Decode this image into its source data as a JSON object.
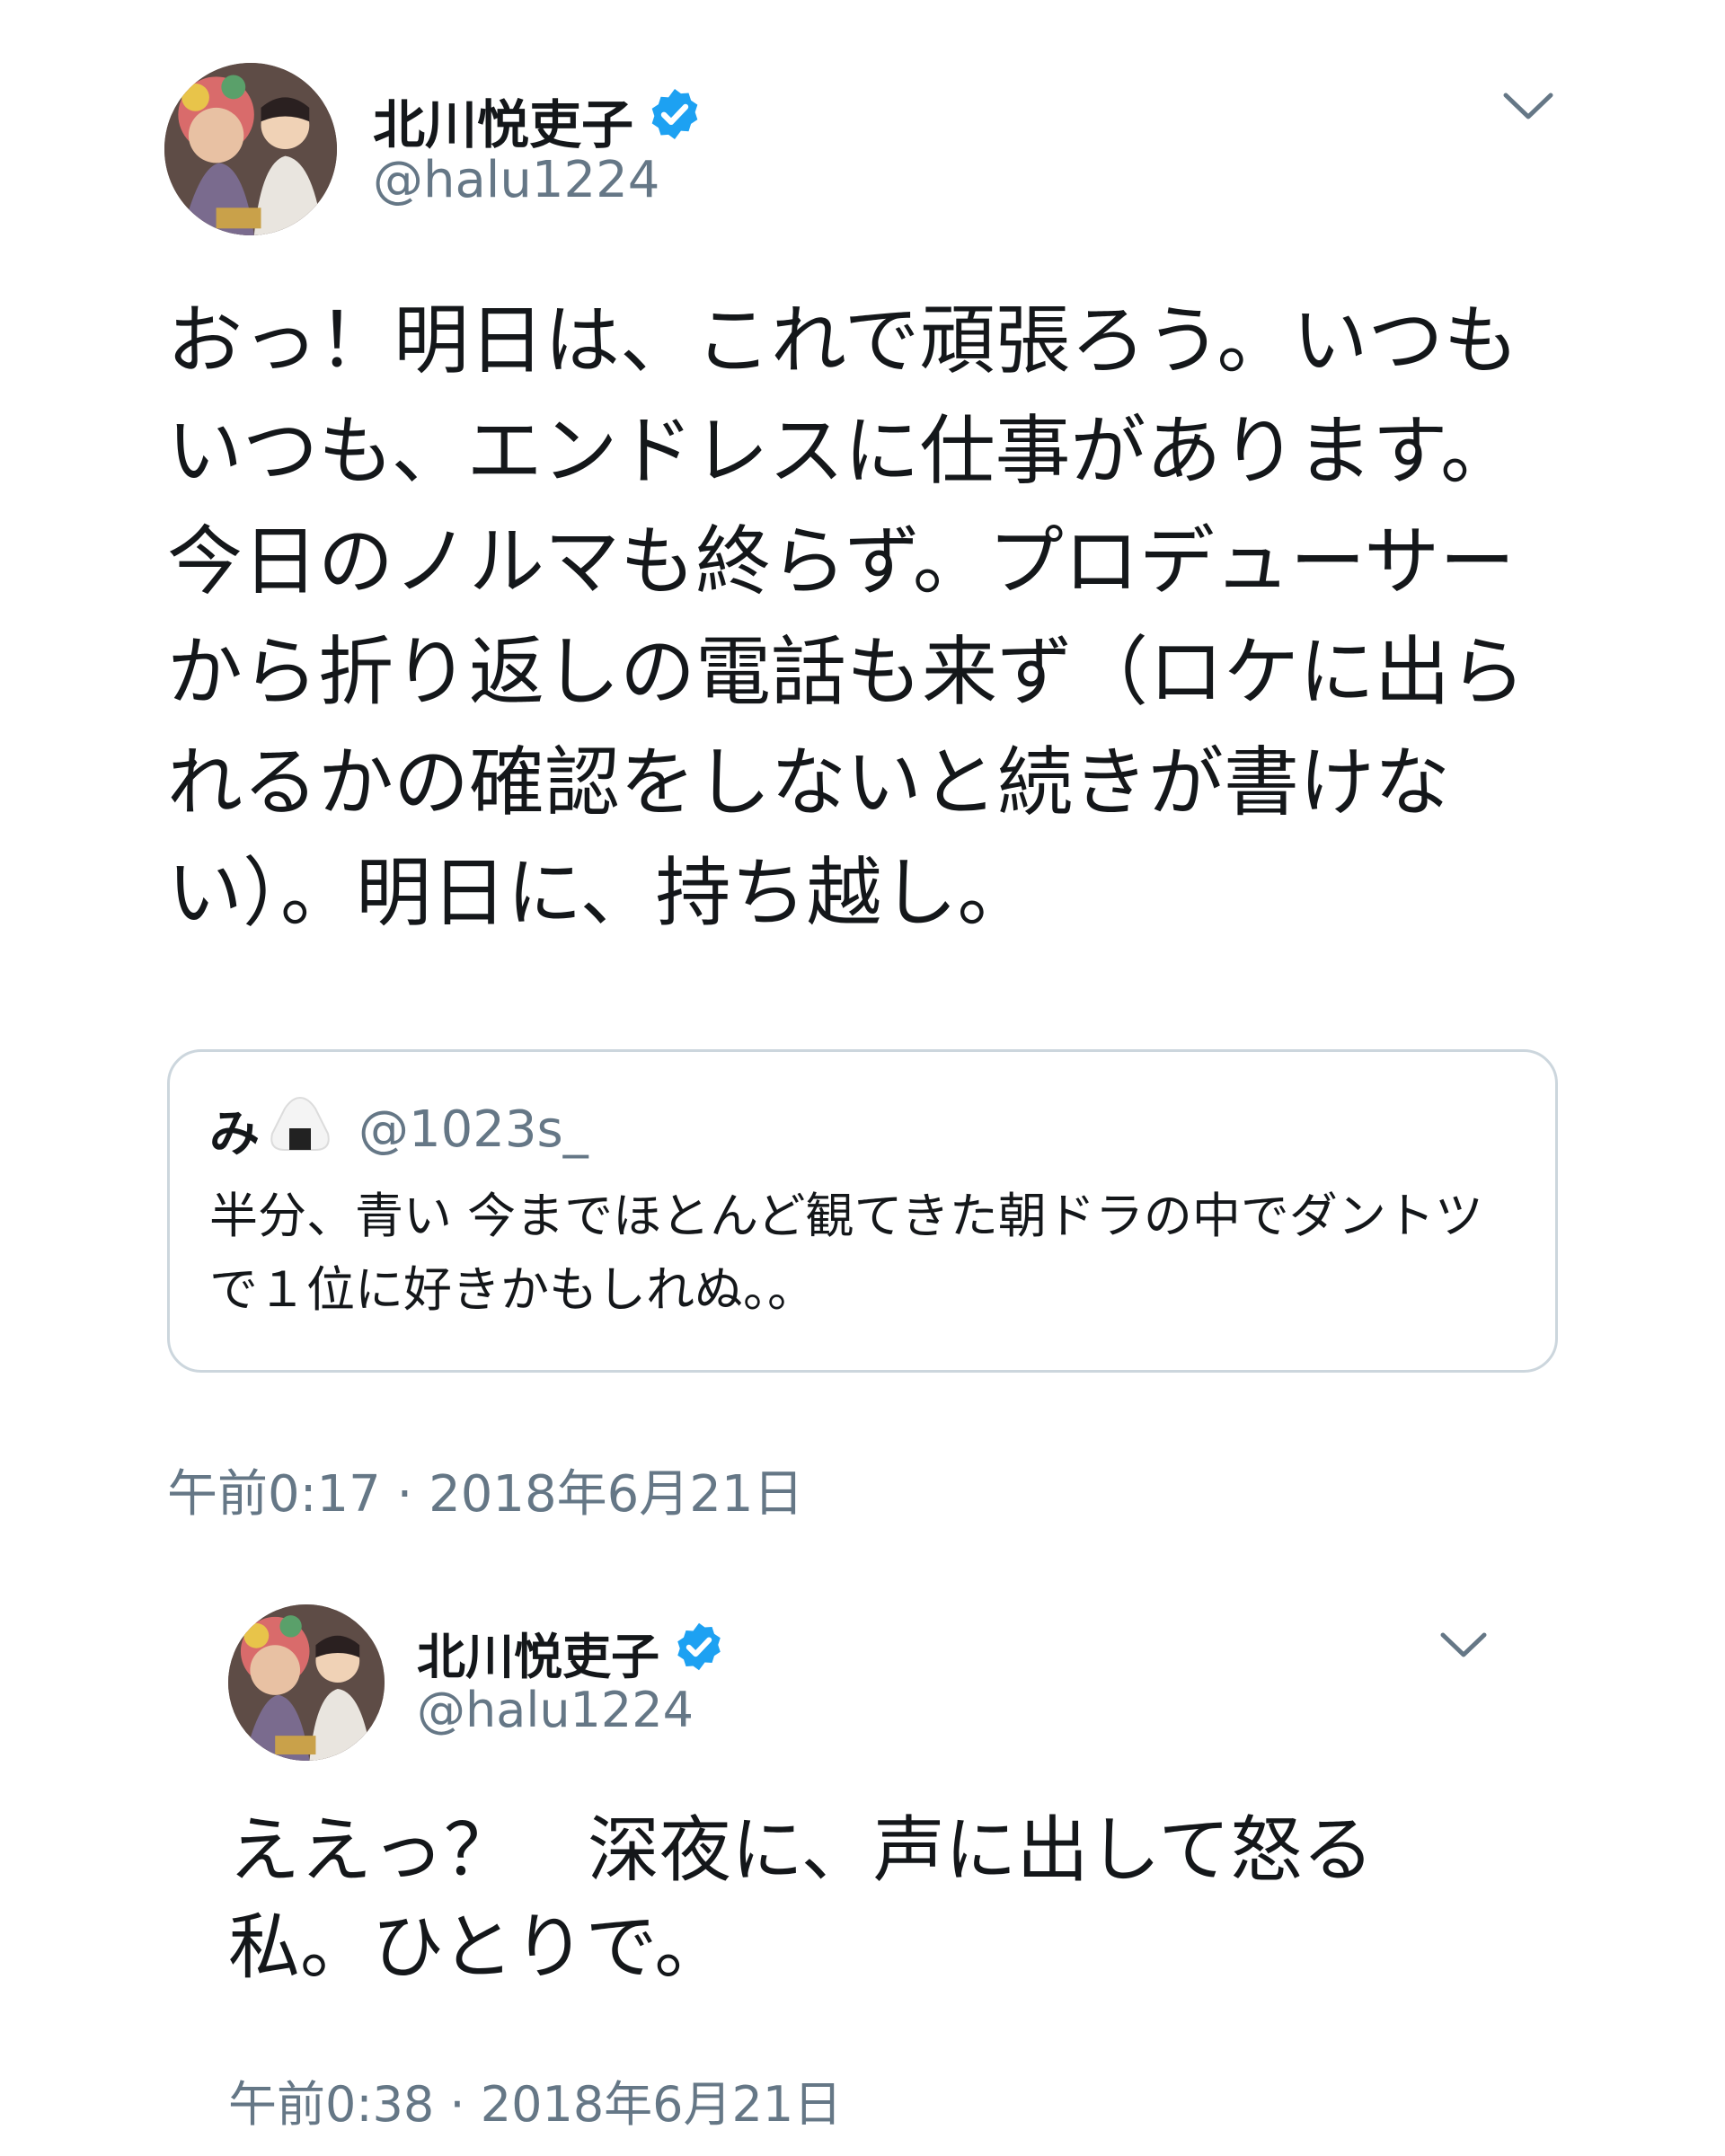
{
  "tweet1": {
    "display_name": "北川悦吏子",
    "handle": "@halu1224",
    "text": "おっ！明日は、これで頑張ろう。いつもいつも、エンドレスに仕事があります。今日のノルマも終らず。プロデューサーから折り返しの電話も来ず（ロケに出られるかの確認をしないと続きが書けない）。明日に、持ち越し。",
    "timestamp": "午前0:17 · 2018年6月21日",
    "verified_icon": "verified-badge-icon",
    "menu_icon": "chevron-down-icon"
  },
  "quoted": {
    "display_name": "み",
    "name_icon": "onigiri-emoji-icon",
    "handle": "@1023s_",
    "text": "半分、青い 今までほとんど観てきた朝ドラの中でダントツで１位に好きかもしれぬ。。"
  },
  "tweet2": {
    "display_name": "北川悦吏子",
    "handle": "@halu1224",
    "text": "ええっ？　深夜に、声に出して怒る私。ひとりで。",
    "timestamp": "午前0:38 · 2018年6月21日",
    "verified_icon": "verified-badge-icon",
    "menu_icon": "chevron-down-icon"
  },
  "colors": {
    "text": "#14171a",
    "secondary": "#657786",
    "verified": "#1da1f2",
    "border": "#ccd6dd",
    "background": "#ffffff"
  }
}
